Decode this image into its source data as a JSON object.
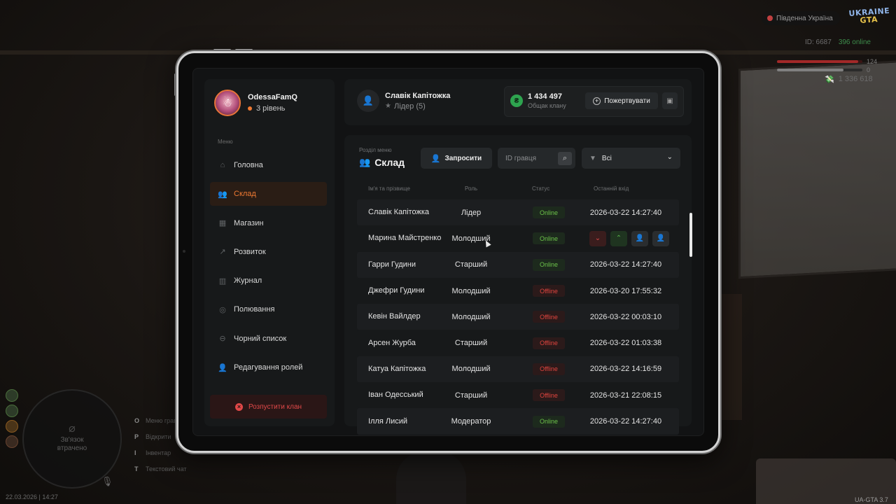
{
  "hud": {
    "server": "Південна Україна",
    "logo_line1": "UKRAINE",
    "logo_line2": "GTA",
    "player_id": "ID: 6687",
    "online": "396 online",
    "health": 124,
    "health_level": 0.95,
    "armor": 0,
    "armor_level": 0.78,
    "money": "1 336 618",
    "minimap_text": "Зв'язок втрачено",
    "hints": [
      {
        "key": "O",
        "label": "Меню гравця"
      },
      {
        "key": "P",
        "label": "Відкрити"
      },
      {
        "key": "I",
        "label": "Інвентар"
      },
      {
        "key": "T",
        "label": "Текстовий чат"
      }
    ],
    "datetime": "22.03.2026 | 14:27",
    "version": "UA-GTA 3.7"
  },
  "profile": {
    "name": "OdessaFamQ",
    "level": "3 рівень"
  },
  "sidebar": {
    "caption": "Меню",
    "items": [
      {
        "label": "Головна",
        "icon": "home-icon",
        "glyph": "⌂"
      },
      {
        "label": "Склад",
        "icon": "people-icon",
        "glyph": "👥"
      },
      {
        "label": "Магазин",
        "icon": "shop-icon",
        "glyph": "▦"
      },
      {
        "label": "Розвиток",
        "icon": "chart-icon",
        "glyph": "↗"
      },
      {
        "label": "Журнал",
        "icon": "book-icon",
        "glyph": "▥"
      },
      {
        "label": "Полювання",
        "icon": "target-icon",
        "glyph": "◎"
      },
      {
        "label": "Чорний список",
        "icon": "blocked-icon",
        "glyph": "⊖"
      },
      {
        "label": "Редагування ролей",
        "icon": "user-edit-icon",
        "glyph": "👤"
      }
    ],
    "active_index": 1,
    "dissolve_label": "Розпустити клан"
  },
  "header": {
    "leader_name": "Славік Капітожка",
    "leader_role": "Лідер (5)",
    "bank_amount": "1 434 497",
    "bank_label": "Общак клану",
    "donate_label": "Пожертвувати"
  },
  "section": {
    "caption": "Розділ меню",
    "title": "Склад",
    "invite_label": "Запросити",
    "search_placeholder": "ID гравця",
    "filter_value": "Всі"
  },
  "table": {
    "columns": [
      "Ім'я та прізвище",
      "Роль",
      "Статус",
      "Останній вхід"
    ],
    "rows": [
      {
        "name": "Славік Капітожка",
        "role": "Лідер",
        "status": "Online",
        "last": "2026-03-22 14:27:40"
      },
      {
        "name": "Марина Майстренко",
        "role": "Молодший",
        "status": "Online",
        "last": "",
        "actions": true
      },
      {
        "name": "Гарри Гудини",
        "role": "Старший",
        "status": "Online",
        "last": "2026-03-22 14:27:40"
      },
      {
        "name": "Джефри Гудини",
        "role": "Молодший",
        "status": "Offline",
        "last": "2026-03-20 17:55:32"
      },
      {
        "name": "Кевін Вайлдер",
        "role": "Молодший",
        "status": "Offline",
        "last": "2026-03-22 00:03:10"
      },
      {
        "name": "Арсен Журба",
        "role": "Старший",
        "status": "Offline",
        "last": "2026-03-22 01:03:38"
      },
      {
        "name": "Катуа Капітожка",
        "role": "Молодший",
        "status": "Offline",
        "last": "2026-03-22 14:16:59"
      },
      {
        "name": "Іван Одесський",
        "role": "Старший",
        "status": "Offline",
        "last": "2026-03-21 22:08:15"
      },
      {
        "name": "Ілля Лисий",
        "role": "Модератор",
        "status": "Online",
        "last": "2026-03-22 14:27:40"
      }
    ]
  },
  "colors": {
    "accent": "#f07a32",
    "online": "#6cc24a",
    "offline": "#e0443e",
    "bank_coin": "#2ea44f"
  }
}
